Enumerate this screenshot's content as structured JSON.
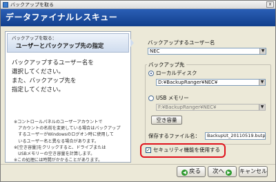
{
  "window": {
    "title": "バックアップを取る",
    "close_label": "x"
  },
  "banner": {
    "heading": "データファイナルレスキュー"
  },
  "step": {
    "number_label": "バックアップを取る：",
    "title": "ユーザーとバックアップ先の指定"
  },
  "instructions": [
    "バックアップするユーザー名を",
    "選択してください。",
    "また、バックアップ先を",
    "指定してください。"
  ],
  "notes": [
    "※コントロールパネルのユーザーアカウントで",
    "　アカウントの名前を変更している場合はバックアップ",
    "　するユーザーがWindowsのログオン時に使用して",
    "　いるユーザー名と異なる場合があります。",
    "※[空き容量]をクリックすると、ドライブまたは",
    "　USBメモリーの空き容量を計算します。",
    "※この処理には時間がかかることがあります。"
  ],
  "user": {
    "label": "バックアップするユーザー名",
    "value": "NEC"
  },
  "destination": {
    "group_label": "バックアップ先",
    "local_label": "ローカルディスク",
    "local_path": "D:¥BackupRanger¥NEC¥",
    "usb_label": "USB メモリー",
    "usb_path": "F:¥BackupRanger¥NEC¥",
    "free_space_label": "空き容量",
    "filename_label": "保存するファイル名：",
    "filename_value": "BackupUt_20110519.butp"
  },
  "security": {
    "label": "セキュリティ機能を使用する",
    "checked": true,
    "highlight_color": "#e0111b"
  },
  "nav": {
    "back_label": "戻る",
    "next_label": "次へ",
    "cancel_label": "キャンセル"
  },
  "colors": {
    "banner": "#1d4a9c",
    "accent_green": "#2e9a2e"
  }
}
